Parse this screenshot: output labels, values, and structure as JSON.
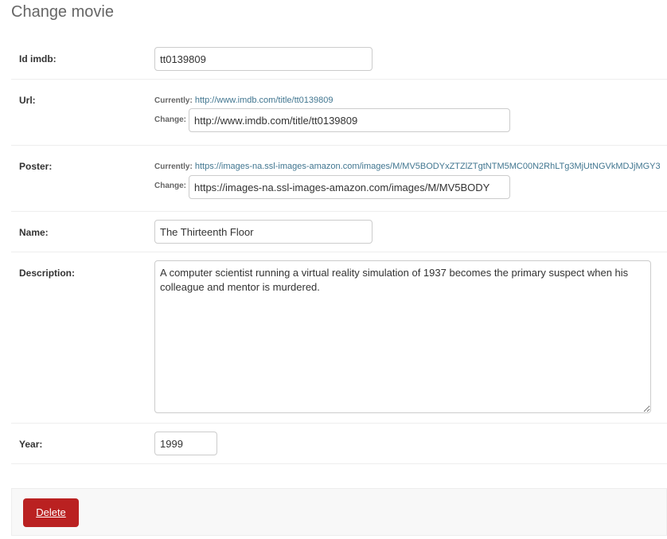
{
  "page": {
    "title": "Change movie"
  },
  "fields": {
    "id_imdb": {
      "label": "Id imdb:",
      "value": "tt0139809"
    },
    "url": {
      "label": "Url:",
      "currently_label": "Currently:",
      "currently_link": "http://www.imdb.com/title/tt0139809",
      "change_label": "Change:",
      "value": "http://www.imdb.com/title/tt0139809"
    },
    "poster": {
      "label": "Poster:",
      "currently_label": "Currently:",
      "currently_link": "https://images-na.ssl-images-amazon.com/images/M/MV5BODYxZTZlZTgtNTM5MC00N2RhLTg3MjUtNGVkMDJjMGY3",
      "change_label": "Change:",
      "value": "https://images-na.ssl-images-amazon.com/images/M/MV5BODY"
    },
    "name": {
      "label": "Name:",
      "value": "The Thirteenth Floor"
    },
    "description": {
      "label": "Description:",
      "value": "A computer scientist running a virtual reality simulation of 1937 becomes the primary suspect when his colleague and mentor is murdered."
    },
    "year": {
      "label": "Year:",
      "value": "1999"
    }
  },
  "actions": {
    "delete_label": "Delete"
  },
  "colors": {
    "link": "#417690",
    "delete_button": "#ba2121",
    "submit_row_bg": "#f8f8f8"
  }
}
